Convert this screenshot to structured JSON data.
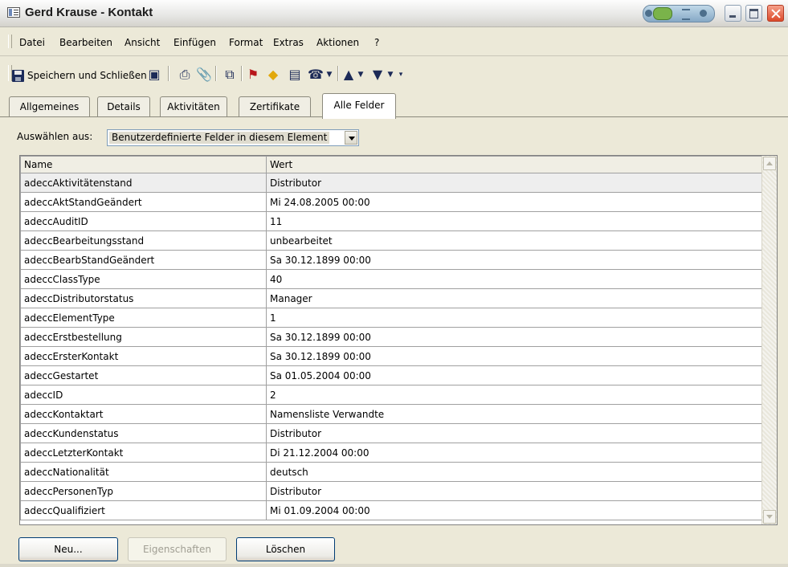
{
  "window": {
    "title": "Gerd Krause - Kontakt"
  },
  "menu": [
    "Datei",
    "Bearbeiten",
    "Ansicht",
    "Einfügen",
    "Format",
    "Extras",
    "Aktionen",
    "?"
  ],
  "toolbar": {
    "save_close_label": "Speichern und Schließen"
  },
  "tabs": [
    "Allgemeines",
    "Details",
    "Aktivitäten",
    "Zertifikate",
    "Alle Felder"
  ],
  "active_tab": "Alle Felder",
  "select": {
    "label": "Auswählen aus:",
    "value": "Benutzerdefinierte Felder in diesem Element"
  },
  "table": {
    "columns": [
      "Name",
      "Wert"
    ],
    "rows": [
      [
        "adeccAktivitätenstand",
        "Distributor"
      ],
      [
        "adeccAktStandGeändert",
        "Mi 24.08.2005 00:00"
      ],
      [
        "adeccAuditID",
        "11"
      ],
      [
        "adeccBearbeitungsstand",
        "unbearbeitet"
      ],
      [
        "adeccBearbStandGeändert",
        "Sa 30.12.1899 00:00"
      ],
      [
        "adeccClassType",
        "40"
      ],
      [
        "adeccDistributorstatus",
        "Manager"
      ],
      [
        "adeccElementType",
        "1"
      ],
      [
        "adeccErstbestellung",
        "Sa 30.12.1899 00:00"
      ],
      [
        "adeccErsterKontakt",
        "Sa 30.12.1899 00:00"
      ],
      [
        "adeccGestartet",
        "Sa 01.05.2004 00:00"
      ],
      [
        "adeccID",
        "2"
      ],
      [
        "adeccKontaktart",
        "Namensliste Verwandte"
      ],
      [
        "adeccKundenstatus",
        "Distributor"
      ],
      [
        "adeccLetzterKontakt",
        "Di 21.12.2004 00:00"
      ],
      [
        "adeccNationalität",
        "deutsch"
      ],
      [
        "adeccPersonenTyp",
        "Distributor"
      ],
      [
        "adeccQualifiziert",
        "Mi 01.09.2004 00:00"
      ]
    ]
  },
  "buttons": {
    "new": "Neu...",
    "properties": "Eigenschaften",
    "delete": "Löschen"
  }
}
